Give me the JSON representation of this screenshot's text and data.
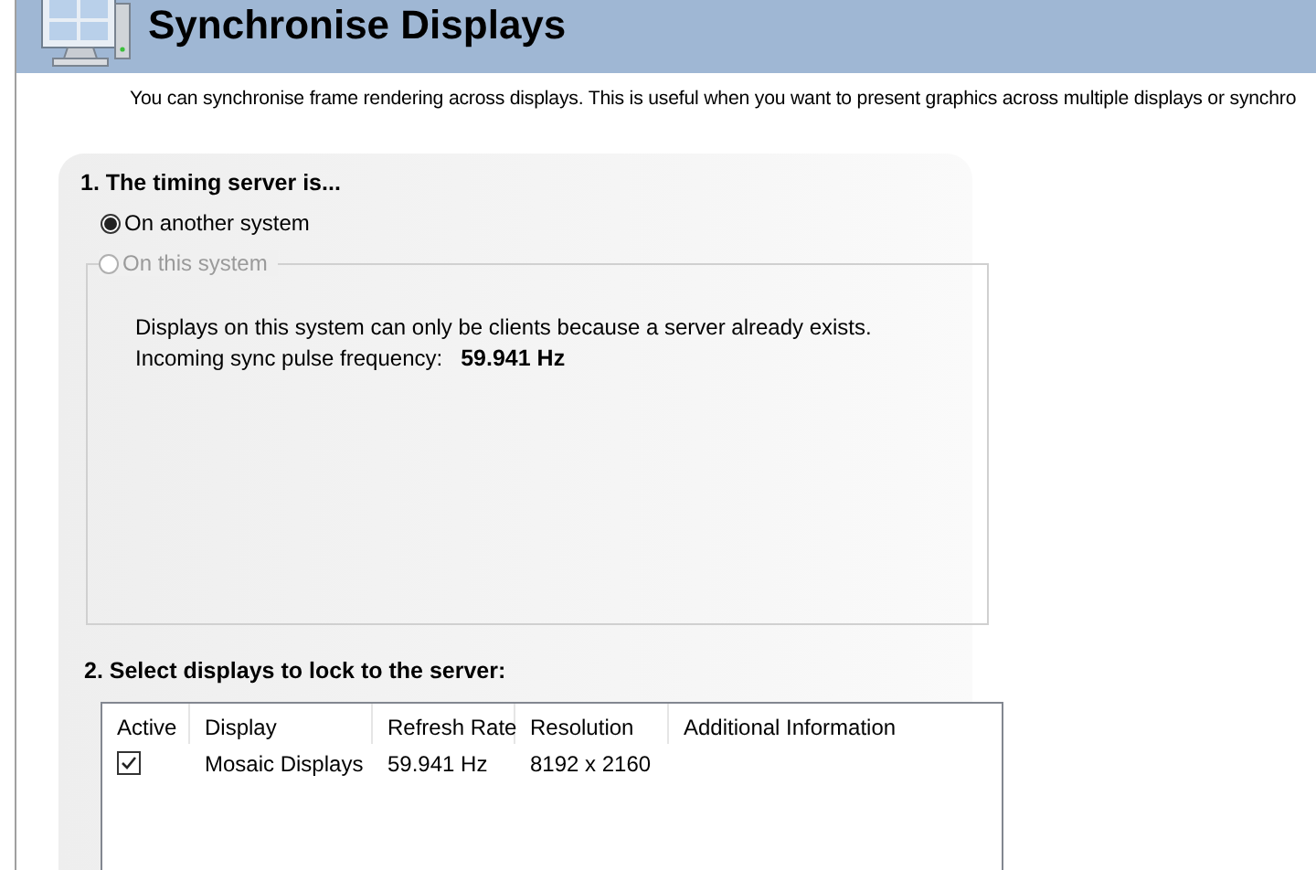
{
  "header": {
    "title": "Synchronise Displays"
  },
  "description": "You can synchronise frame rendering across displays. This is useful when you want to present graphics across multiple displays or synchro",
  "timing_section": {
    "heading": "1. The timing server is...",
    "options": [
      {
        "label": "On another system",
        "selected": true,
        "disabled": false
      },
      {
        "label": "On this system",
        "selected": false,
        "disabled": true
      }
    ],
    "info": "Displays on this system can only be clients because a server already exists.",
    "frequency_label": "Incoming sync pulse frequency:",
    "frequency_value": "59.941 Hz"
  },
  "displays_section": {
    "heading": "2. Select displays to lock to the server:",
    "columns": [
      "Active",
      "Display",
      "Refresh Rate",
      "Resolution",
      "Additional Information"
    ],
    "rows": [
      {
        "active": true,
        "display": "Mosaic Displays",
        "refresh_rate": "59.941 Hz",
        "resolution": "8192 x 2160"
      }
    ]
  }
}
